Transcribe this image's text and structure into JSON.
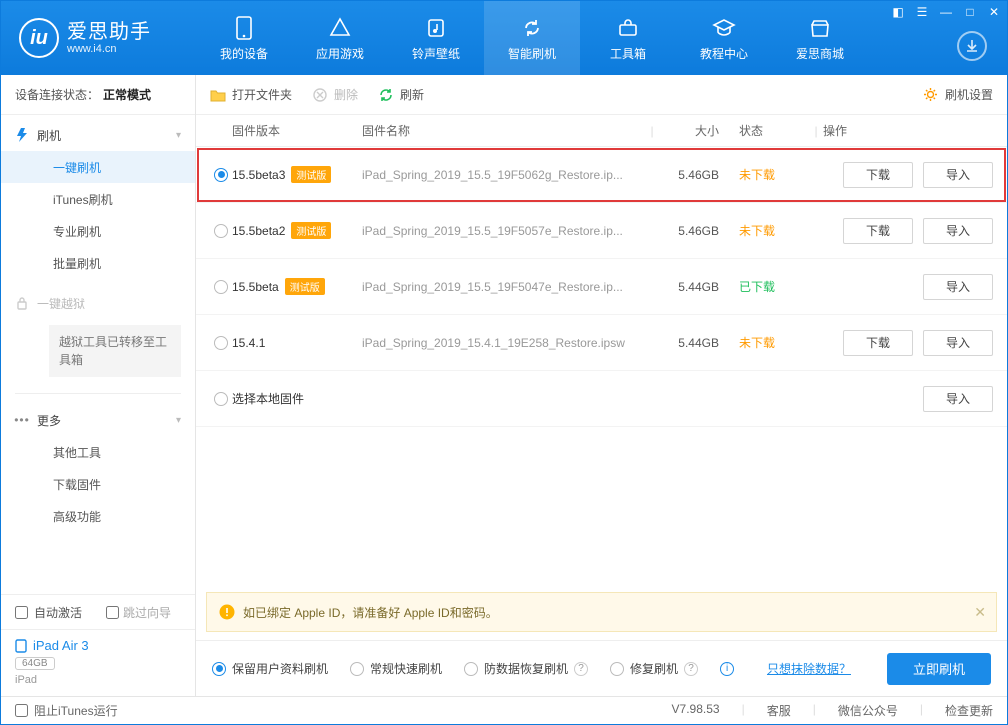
{
  "brand": {
    "cn": "爱思助手",
    "en": "www.i4.cn"
  },
  "topnav": {
    "my_device": "我的设备",
    "apps": "应用游戏",
    "ringtones": "铃声壁纸",
    "flash": "智能刷机",
    "toolbox": "工具箱",
    "tutorials": "教程中心",
    "store": "爱思商城"
  },
  "sidebar": {
    "conn_label": "设备连接状态：",
    "conn_value": "正常模式",
    "section_flash": "刷机",
    "items_flash": {
      "one_key": "一键刷机",
      "itunes": "iTunes刷机",
      "pro": "专业刷机",
      "batch": "批量刷机"
    },
    "section_jb": "一键越狱",
    "jb_note": "越狱工具已转移至工具箱",
    "section_more": "更多",
    "items_more": {
      "other_tools": "其他工具",
      "download_fw": "下载固件",
      "advanced": "高级功能"
    },
    "auto_activate": "自动激活",
    "skip_guide": "跳过向导",
    "device_name": "iPad Air 3",
    "device_cap": "64GB",
    "device_type": "iPad"
  },
  "toolbar": {
    "open_folder": "打开文件夹",
    "delete": "删除",
    "refresh": "刷新",
    "settings": "刷机设置"
  },
  "columns": {
    "version": "固件版本",
    "name": "固件名称",
    "size": "大小",
    "status": "状态",
    "action": "操作"
  },
  "tag_beta": "测试版",
  "status_text": {
    "not_downloaded": "未下载",
    "downloaded": "已下载"
  },
  "actions": {
    "download": "下载",
    "import": "导入"
  },
  "local_fw_label": "选择本地固件",
  "rows": [
    {
      "version": "15.5beta3",
      "beta": true,
      "name": "iPad_Spring_2019_15.5_19F5062g_Restore.ip...",
      "size": "5.46GB",
      "status": "not_downloaded",
      "selected": true,
      "show_download": true
    },
    {
      "version": "15.5beta2",
      "beta": true,
      "name": "iPad_Spring_2019_15.5_19F5057e_Restore.ip...",
      "size": "5.46GB",
      "status": "not_downloaded",
      "selected": false,
      "show_download": true
    },
    {
      "version": "15.5beta",
      "beta": true,
      "name": "iPad_Spring_2019_15.5_19F5047e_Restore.ip...",
      "size": "5.44GB",
      "status": "downloaded",
      "selected": false,
      "show_download": false
    },
    {
      "version": "15.4.1",
      "beta": false,
      "name": "iPad_Spring_2019_15.4.1_19E258_Restore.ipsw",
      "size": "5.44GB",
      "status": "not_downloaded",
      "selected": false,
      "show_download": true
    }
  ],
  "notice": "如已绑定 Apple ID，请准备好 Apple ID和密码。",
  "flash_options": {
    "keep_data": "保留用户资料刷机",
    "normal": "常规快速刷机",
    "anti_recovery": "防数据恢复刷机",
    "repair": "修复刷机",
    "erase_link": "只想抹除数据？",
    "go": "立即刷机"
  },
  "statusbar": {
    "block_itunes": "阻止iTunes运行",
    "version": "V7.98.53",
    "service": "客服",
    "wechat": "微信公众号",
    "check_update": "检查更新"
  }
}
